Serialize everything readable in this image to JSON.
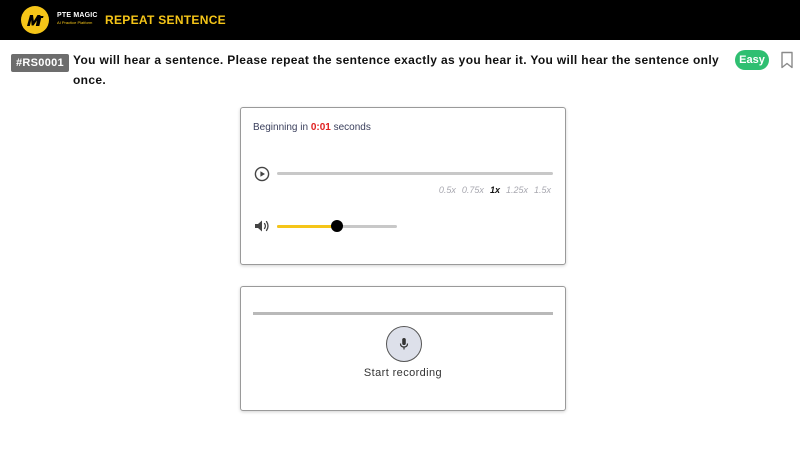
{
  "header": {
    "brand_name": "PTE MAGIC",
    "brand_tagline": "AI Practice Platform",
    "section_title": "REPEAT SENTENCE",
    "accent_color": "#f5c518"
  },
  "question": {
    "id": "#RS0001",
    "instruction": "You will hear a sentence. Please repeat the sentence exactly as you hear it. You will hear the sentence only once.",
    "difficulty": "Easy",
    "difficulty_color": "#2fbf71"
  },
  "player": {
    "countdown_prefix": "Beginning in",
    "countdown_time": "0:01",
    "countdown_suffix": "seconds",
    "progress": 0,
    "speeds": [
      "0.5x",
      "0.75x",
      "1x",
      "1.25x",
      "1.5x"
    ],
    "active_speed": "1x",
    "volume": 0.5
  },
  "recorder": {
    "label": "Start recording",
    "progress": 0
  },
  "icons": {
    "logo": "pte-magic-logo",
    "bookmark": "bookmark-icon",
    "play": "play-circle-icon",
    "volume": "speaker-icon",
    "mic": "microphone-icon"
  }
}
